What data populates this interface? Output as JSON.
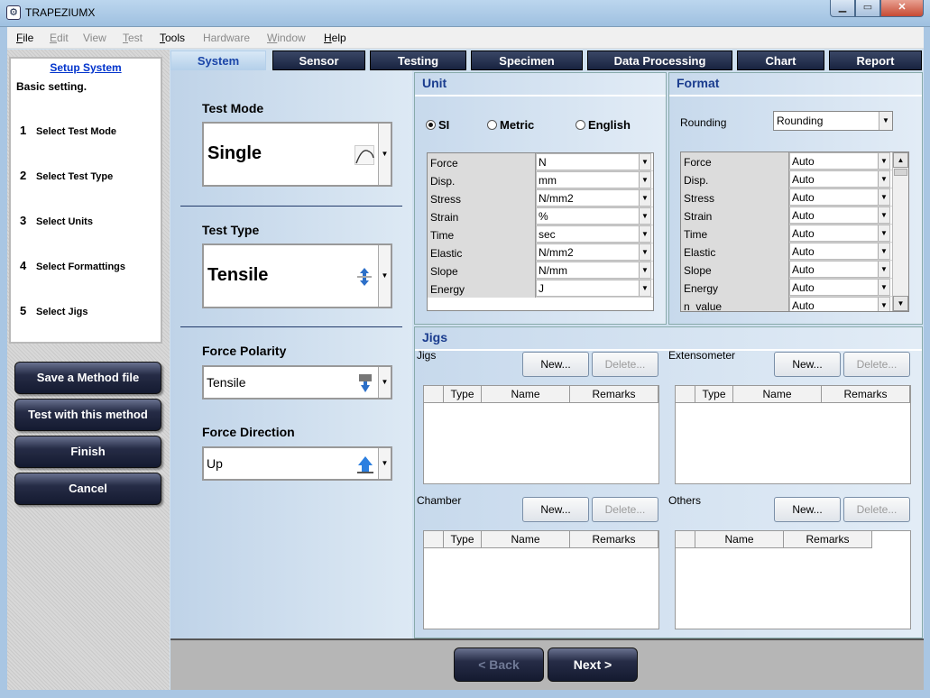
{
  "window": {
    "title": "TRAPEZIUMX"
  },
  "menu": [
    {
      "label": "File",
      "ul": "F",
      "rest": "ile",
      "enabled": true
    },
    {
      "label": "Edit",
      "ul": "E",
      "rest": "dit",
      "enabled": false
    },
    {
      "label": "View",
      "ul": "",
      "rest": "View",
      "enabled": false
    },
    {
      "label": "Test",
      "ul": "T",
      "rest": "est",
      "enabled": false
    },
    {
      "label": "Tools",
      "ul": "T",
      "rest": "ools",
      "enabled": true
    },
    {
      "label": "Hardware",
      "ul": "",
      "rest": "Hardware",
      "enabled": false
    },
    {
      "label": "Window",
      "ul": "W",
      "rest": "indow",
      "enabled": false
    },
    {
      "label": "Help",
      "ul": "H",
      "rest": "elp",
      "enabled": true
    }
  ],
  "steps": {
    "title": "Setup System",
    "subtitle": "Basic setting.",
    "items": [
      {
        "num": "1",
        "label": "Select Test Mode"
      },
      {
        "num": "2",
        "label": "Select Test Type"
      },
      {
        "num": "3",
        "label": "Select Units"
      },
      {
        "num": "4",
        "label": "Select Formattings"
      },
      {
        "num": "5",
        "label": "Select Jigs"
      }
    ]
  },
  "actions": {
    "save": "Save a Method file",
    "test": "Test with this method",
    "finish": "Finish",
    "cancel": "Cancel"
  },
  "tabs": [
    "System",
    "Sensor",
    "Testing",
    "Specimen",
    "Data Processing",
    "Chart",
    "Report"
  ],
  "system": {
    "test_mode_label": "Test Mode",
    "test_mode_value": "Single",
    "test_type_label": "Test Type",
    "test_type_value": "Tensile",
    "force_polarity_label": "Force Polarity",
    "force_polarity_value": "Tensile",
    "force_direction_label": "Force Direction",
    "force_direction_value": "Up"
  },
  "unit": {
    "title": "Unit",
    "radios": {
      "si": "SI",
      "metric": "Metric",
      "english": "English",
      "selected": "SI"
    },
    "rows": [
      {
        "k": "Force",
        "v": "N"
      },
      {
        "k": "Disp.",
        "v": "mm"
      },
      {
        "k": "Stress",
        "v": "N/mm2"
      },
      {
        "k": "Strain",
        "v": "%"
      },
      {
        "k": "Time",
        "v": "sec"
      },
      {
        "k": "Elastic",
        "v": "N/mm2"
      },
      {
        "k": "Slope",
        "v": "N/mm"
      },
      {
        "k": "Energy",
        "v": "J"
      }
    ]
  },
  "format": {
    "title": "Format",
    "rounding_label": "Rounding",
    "rounding_value": "Rounding",
    "rows": [
      {
        "k": "Force",
        "v": "Auto"
      },
      {
        "k": "Disp.",
        "v": "Auto"
      },
      {
        "k": "Stress",
        "v": "Auto"
      },
      {
        "k": "Strain",
        "v": "Auto"
      },
      {
        "k": "Time",
        "v": "Auto"
      },
      {
        "k": "Elastic",
        "v": "Auto"
      },
      {
        "k": "Slope",
        "v": "Auto"
      },
      {
        "k": "Energy",
        "v": "Auto"
      },
      {
        "k": "n_value",
        "v": "Auto"
      }
    ]
  },
  "jigs": {
    "title": "Jigs",
    "new_label": "New...",
    "delete_label": "Delete...",
    "sections": {
      "jigs": "Jigs",
      "extensometer": "Extensometer",
      "chamber": "Chamber",
      "others": "Others"
    },
    "col_type": "Type",
    "col_name": "Name",
    "col_remarks": "Remarks"
  },
  "nav": {
    "back": "< Back",
    "next": "Next >"
  }
}
